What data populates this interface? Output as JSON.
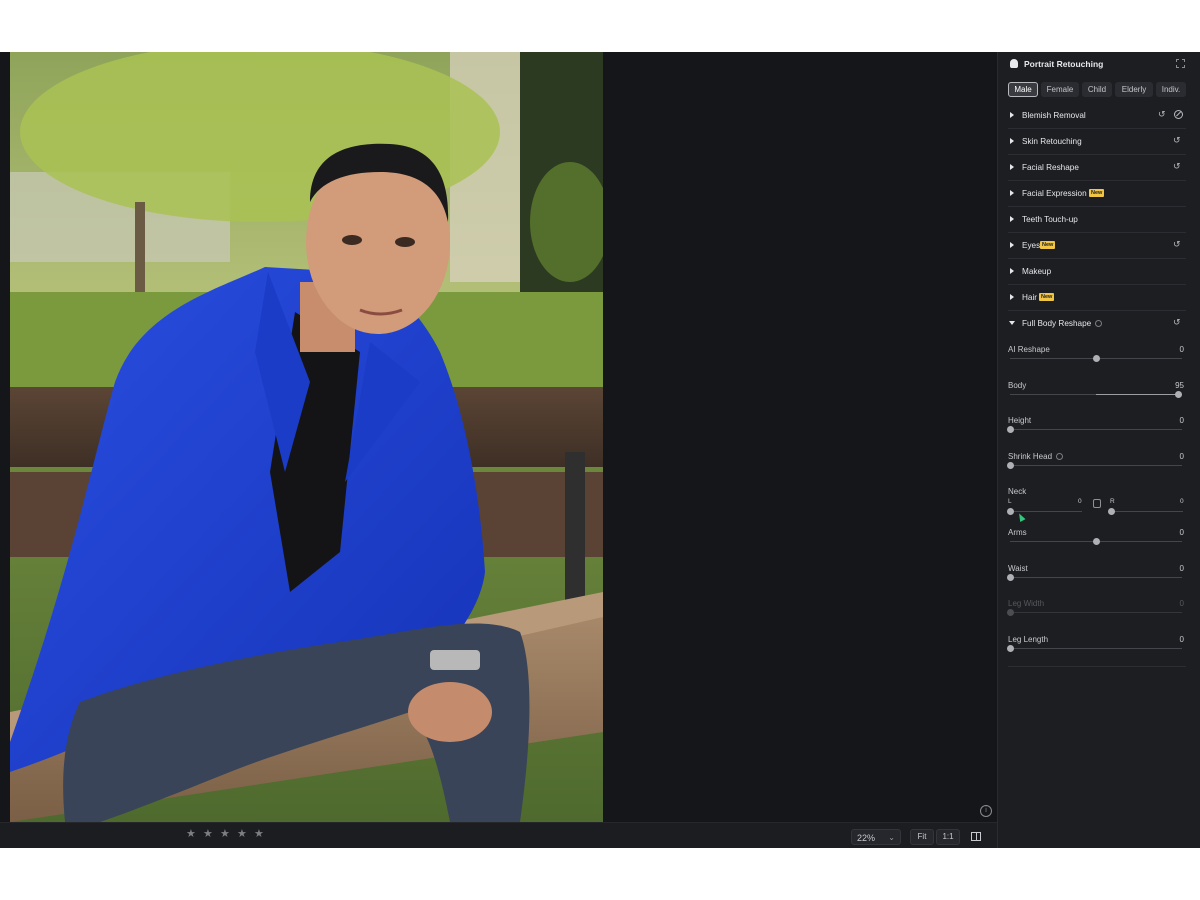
{
  "panel": {
    "title": "Portrait Retouching",
    "gender_tabs": [
      "Male",
      "Female",
      "Child",
      "Elderly",
      "Indiv."
    ],
    "active_tab": "Male",
    "sections": [
      {
        "label": "Blemish Removal",
        "badge": "",
        "reset": true,
        "wand": true
      },
      {
        "label": "Skin Retouching",
        "badge": "",
        "reset": true,
        "wand": false
      },
      {
        "label": "Facial Reshape",
        "badge": "",
        "reset": true,
        "wand": false
      },
      {
        "label": "Facial Expression",
        "badge": "New",
        "reset": false,
        "wand": false
      },
      {
        "label": "Teeth Touch-up",
        "badge": "",
        "reset": false,
        "wand": false
      },
      {
        "label": "Eyes",
        "badge": "New",
        "reset": true,
        "wand": false
      },
      {
        "label": "Makeup",
        "badge": "",
        "reset": false,
        "wand": false
      },
      {
        "label": "Hair",
        "badge": "New",
        "reset": false,
        "wand": false
      }
    ],
    "full_body": {
      "label": "Full Body Reshape",
      "sliders": [
        {
          "label": "AI Reshape",
          "value": "0",
          "level": 0.5,
          "info": false,
          "disabled": false
        },
        {
          "label": "Body",
          "value": "95",
          "level": 0.975,
          "info": false,
          "disabled": false,
          "bipolar": true
        },
        {
          "label": "Height",
          "value": "0",
          "level": 0,
          "info": false,
          "disabled": false
        },
        {
          "label": "Shrink Head",
          "value": "0",
          "level": 0,
          "info": true,
          "disabled": false
        },
        {
          "label": "Arms",
          "value": "0",
          "level": 0.5,
          "info": false,
          "disabled": false
        },
        {
          "label": "Waist",
          "value": "0",
          "level": 0,
          "info": false,
          "disabled": false
        },
        {
          "label": "Leg Width",
          "value": "0",
          "level": 0,
          "info": false,
          "disabled": true
        },
        {
          "label": "Leg Length",
          "value": "0",
          "level": 0,
          "info": false,
          "disabled": false
        }
      ],
      "neck": {
        "label": "Neck",
        "left_label": "L",
        "left_value": "0",
        "right_label": "R",
        "right_value": "0"
      }
    }
  },
  "bottom_bar": {
    "rating_stars": 5,
    "star_glyph": "★",
    "zoom": "22%",
    "fit_label": "Fit",
    "one_to_one_label": "1:1"
  },
  "icons": {
    "reset": "↺",
    "info": "i",
    "chevron": "⌄"
  },
  "colors": {
    "accent_new_badge": "#f1c644",
    "cursor": "#34c77b",
    "panel_bg": "#1d1e22",
    "app_bg": "#151619"
  }
}
